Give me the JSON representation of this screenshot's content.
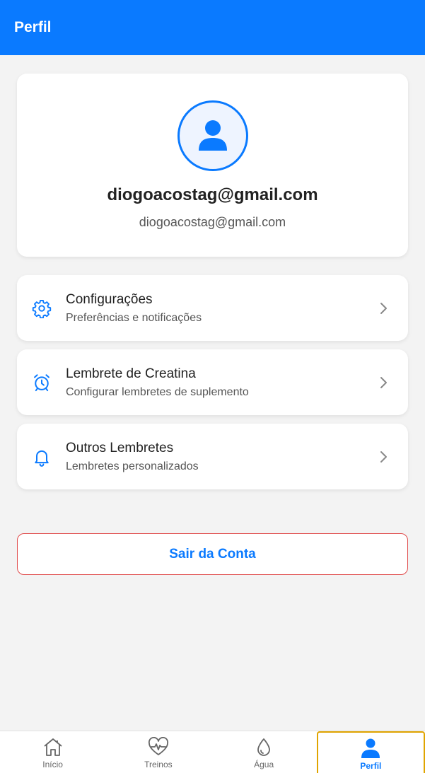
{
  "header": {
    "title": "Perfil"
  },
  "profile": {
    "name": "diogoacostag@gmail.com",
    "email": "diogoacostag@gmail.com"
  },
  "menu": [
    {
      "title": "Configurações",
      "subtitle": "Preferências e notificações",
      "icon": "gear-icon"
    },
    {
      "title": "Lembrete de Creatina",
      "subtitle": "Configurar lembretes de suplemento",
      "icon": "alarm-clock-icon"
    },
    {
      "title": "Outros Lembretes",
      "subtitle": "Lembretes personalizados",
      "icon": "bell-icon"
    }
  ],
  "logout": {
    "label": "Sair da Conta"
  },
  "tabs": [
    {
      "label": "Início",
      "icon": "home-icon"
    },
    {
      "label": "Treinos",
      "icon": "heart-pulse-icon"
    },
    {
      "label": "Água",
      "icon": "water-drop-icon"
    },
    {
      "label": "Perfil",
      "icon": "person-icon",
      "active": true
    }
  ],
  "colors": {
    "primary": "#0a7aff",
    "danger_border": "#e04a4a",
    "active_tab_outline": "#e0a400"
  }
}
